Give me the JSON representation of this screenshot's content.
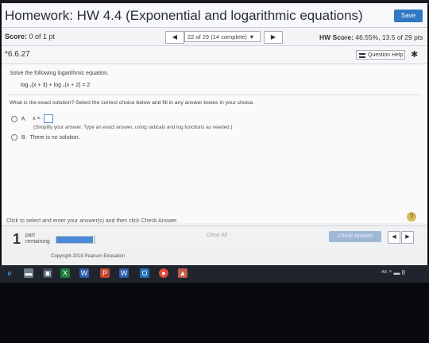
{
  "header": {
    "title": "Homework: HW 4.4 (Exponential and logarithmic equations)",
    "save_label": "Save"
  },
  "status": {
    "score_label": "Score:",
    "score_value": "0 of 1 pt",
    "question_selector": "22 of 29 (14 complete) ▼",
    "prev_icon": "triangle-left-icon",
    "next_icon": "triangle-right-icon",
    "hw_score_label": "HW Score:",
    "hw_score_value": "46.55%, 13.5 of 29 pts"
  },
  "question": {
    "number": "*6.6.27",
    "help_label": "Question Help",
    "instruction": "Solve the following logarithmic equation.",
    "equation": "log ₇(x + 3) + log ₇(x + 2) = 2",
    "prompt": "What is the exact solution? Select the correct choice below and fill in any answer boxes in your choice.",
    "option_a_letter": "A.",
    "option_a_text": "x =",
    "option_a_hint": "(Simplify your answer. Type an exact answer, using radicals and log functions as needed.)",
    "option_b_letter": "B.",
    "option_b_text": "There is no solution."
  },
  "footer": {
    "instruction": "Click to select and enter your answer(s) and then click Check Answer.",
    "help_symbol": "?",
    "parts_count": "1",
    "parts_label_1": "part",
    "parts_label_2": "remaining",
    "progress_fraction": 0.95,
    "clear_all_label": "Clear All",
    "check_answer_label": "Check Answer",
    "copyright": "Copyright 2018 Pearson Education"
  },
  "taskbar": {
    "tray_text": "ᴬᴬ  ^  ▬  8"
  },
  "colors": {
    "accent": "#2f78c4",
    "progress": "#4a8ad6"
  }
}
